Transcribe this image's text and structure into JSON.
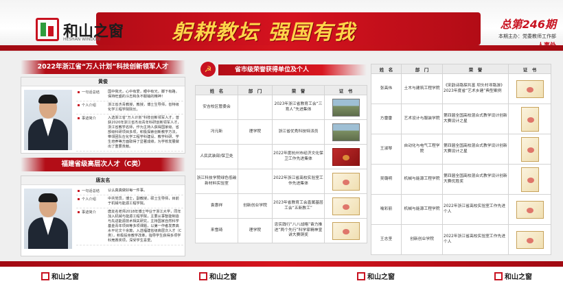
{
  "header": {
    "logo_text": "和山之窗",
    "logo_sub": "HESHAN WINDOW",
    "slogan": "躬耕教坛  强国有我",
    "issue_number": "总第246期",
    "issue_sub": "本期主办：党委教师工作部",
    "issue_tag": "人事处"
  },
  "left": {
    "section1_title": "2022年浙江省“万人计划”科技创新领军人才",
    "person1": {
      "name": "黄俊",
      "rows": [
        {
          "key": "一句话总结",
          "value": "国中我光，心中有爱，眼中有光，脚下有路，保持旺盛的斗志和永不服输的精神！"
        },
        {
          "key": "个人介绍",
          "value": "浙江省杰青教授，教授，博士生导师，省特级化学工程学院院长。"
        },
        {
          "key": "事迹简介",
          "value": "入选浙江省“万人计划”科技创新领军人才，曾获2020年浙江省杰出青年科研创新领军人才，浙江省教学名师，作为主持人获得国家级、省部级科研项目多项，积极探索创新教学方法，带领团队在化学工程学科建设、教学科研、学生培养等方面取得了显著成绩，为学校发展做出了重要贡献。"
        }
      ]
    },
    "section2_title": "福建省级高层次人才（C类）",
    "person2": {
      "name": "唐友名",
      "rows": [
        {
          "key": "一句话总结",
          "value": "认认真真做好每一件事。"
        },
        {
          "key": "个人介绍",
          "value": "中共党员，博士，副教授，硕士生导师，目前于机械与能源工程学院。"
        },
        {
          "key": "事迹简介",
          "value": "唐友名老师2018年博士毕业于浙江大学，同年加入机械与能源工程学院，主要从事智能制造与先进能源技术相关研究，主持国家自然科学基金青年项目等多项课题，以第一作者发表高水平论文十余篇，入选福建省级高层次人才（C类），积极投身教学改革，指导学生获得多项学科竞赛奖项，深受学生喜爱。"
        }
      ]
    }
  },
  "middle": {
    "title": "省市级荣誉获得单位及个人",
    "emblem": "☭",
    "headers": [
      "姓　名",
      "部　门",
      "荣　誉",
      "证　书"
    ],
    "rows": [
      {
        "name": "安吉校区管委会",
        "dept": "",
        "honor": "2023年浙江省教育工会“三育人”先进集体",
        "cert": "photo"
      },
      {
        "name": "冯元新",
        "dept": "理学院",
        "honor": "浙江省优秀科技特派员",
        "cert": "photo"
      },
      {
        "name": "人民武装部/保卫处",
        "dept": "",
        "honor": "2022年度杭州市经济文化保卫工作先进集体",
        "cert": "red"
      },
      {
        "name": "浙江科技学院绿色低碳新材料实验室",
        "dept": "",
        "honor": "2022年浙江省高校实验室工作先进集体",
        "cert": "cert"
      },
      {
        "name": "袁惠祥",
        "dept": "创新创业学院",
        "honor": "2023年省教育工会直属基层工会“五新教工”",
        "cert": "cert"
      },
      {
        "name": "来雪琦",
        "dept": "理学院",
        "honor": "忠实践行“八八战略”奋力推进“两个先行”科学家精神宣讲大赛铜奖",
        "cert": "cert"
      }
    ]
  },
  "right": {
    "headers": [
      "姓　名",
      "部　门",
      "荣　誉",
      "证　书"
    ],
    "rows": [
      {
        "name": "张高伟",
        "dept": "土木与建筑工程学院",
        "honor": "《宋韵诗路探共富 坝头村寻路游》2023年度省“艺术乡建”典型案例"
      },
      {
        "name": "方雷雷",
        "dept": "艺术设计与服装学院",
        "honor": "第四届全国高校混合式教学设计创新大赛设计之星"
      },
      {
        "name": "王淑琴",
        "dept": "自动化与电气工程学院",
        "honor": "第四届全国高校混合式教学设计创新大赛设计之星"
      },
      {
        "name": "吴璐明",
        "dept": "机械与能源工程学院",
        "honor": "第四届全国高校混合式教学设计创新大赛优胜奖"
      },
      {
        "name": "喻彩丽",
        "dept": "机械与能源工程学院",
        "honor": "2022年浙江省高校实验室工作先进个人"
      },
      {
        "name": "王志坚",
        "dept": "创新创业学院",
        "honor": "2022年浙江省高校实验室工作先进个人"
      }
    ]
  },
  "footer": {
    "logo_text": "和山之窗"
  },
  "colors": {
    "brand_red": "#c81220",
    "slogan_gold": "#ffd54a",
    "logo_green": "#2e9c3d"
  }
}
